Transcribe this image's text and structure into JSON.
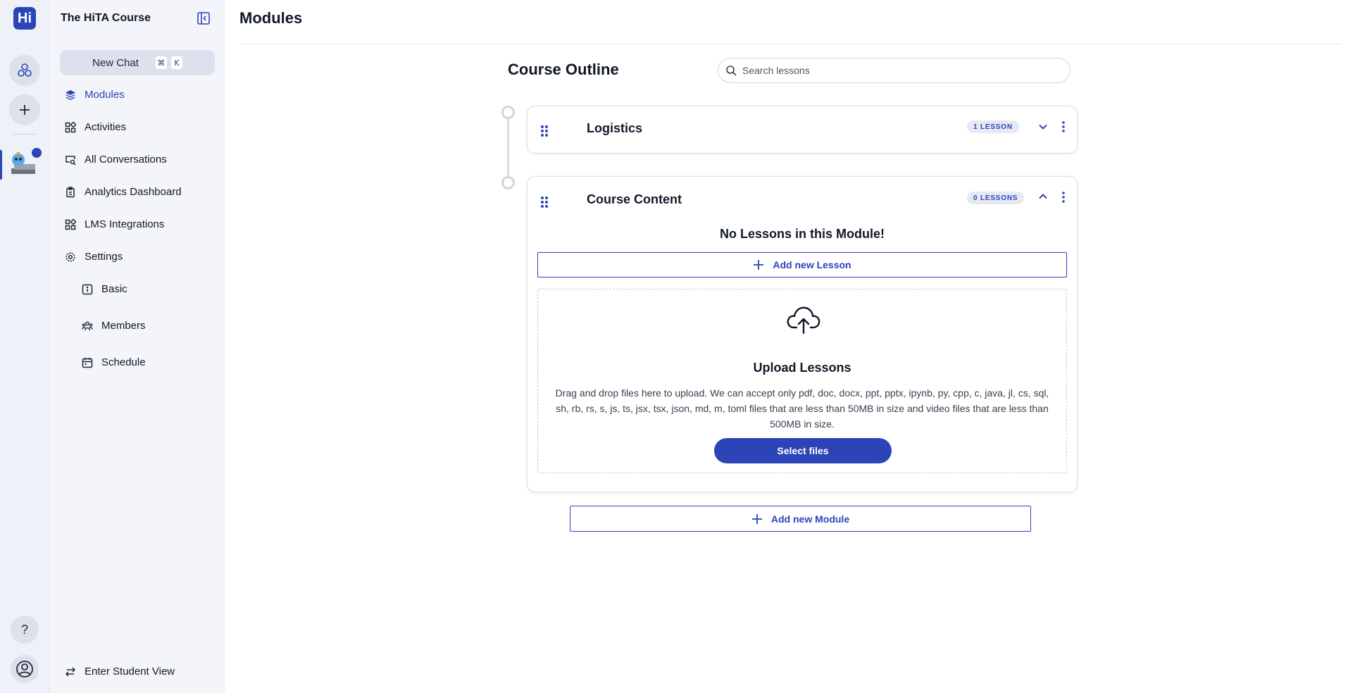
{
  "rail": {
    "logo_text": "Hi",
    "help_glyph": "?",
    "brand_color": "#2b44b8"
  },
  "sidebar": {
    "course_title": "The HiTA Course",
    "new_chat": {
      "label": "New Chat",
      "key_1": "⌘",
      "key_2": "K"
    },
    "items": [
      {
        "label": "Modules",
        "icon": "layers-icon",
        "active": true
      },
      {
        "label": "Activities",
        "icon": "grid-icon"
      },
      {
        "label": "All Conversations",
        "icon": "chat-search-icon"
      },
      {
        "label": "Analytics Dashboard",
        "icon": "clipboard-icon"
      },
      {
        "label": "LMS Integrations",
        "icon": "grid-icon"
      },
      {
        "label": "Settings",
        "icon": "gear-icon"
      }
    ],
    "sub_items": [
      {
        "label": "Basic",
        "icon": "info-box-icon"
      },
      {
        "label": "Members",
        "icon": "members-icon"
      },
      {
        "label": "Schedule",
        "icon": "calendar-icon"
      }
    ],
    "student_view": "Enter Student View"
  },
  "main": {
    "page_title": "Modules",
    "outline_title": "Course Outline",
    "search": {
      "placeholder": "Search lessons"
    },
    "modules": [
      {
        "name": "Logistics",
        "badge": "1 LESSON",
        "expanded": false
      },
      {
        "name": "Course Content",
        "badge": "0 LESSONS",
        "expanded": true,
        "empty_message": "No Lessons in this Module!",
        "add_lesson": "Add new Lesson",
        "upload": {
          "title": "Upload Lessons",
          "description": "Drag and drop files here to upload. We can accept only pdf, doc, docx, ppt, pptx, ipynb, py, cpp, c, java, jl, cs, sql, sh, rb, rs, s, js, ts, jsx, tsx, json, md, m, toml files that are less than 50MB in size and video files that are less than 500MB in size.",
          "button": "Select files"
        }
      }
    ],
    "add_module": "Add new Module"
  }
}
